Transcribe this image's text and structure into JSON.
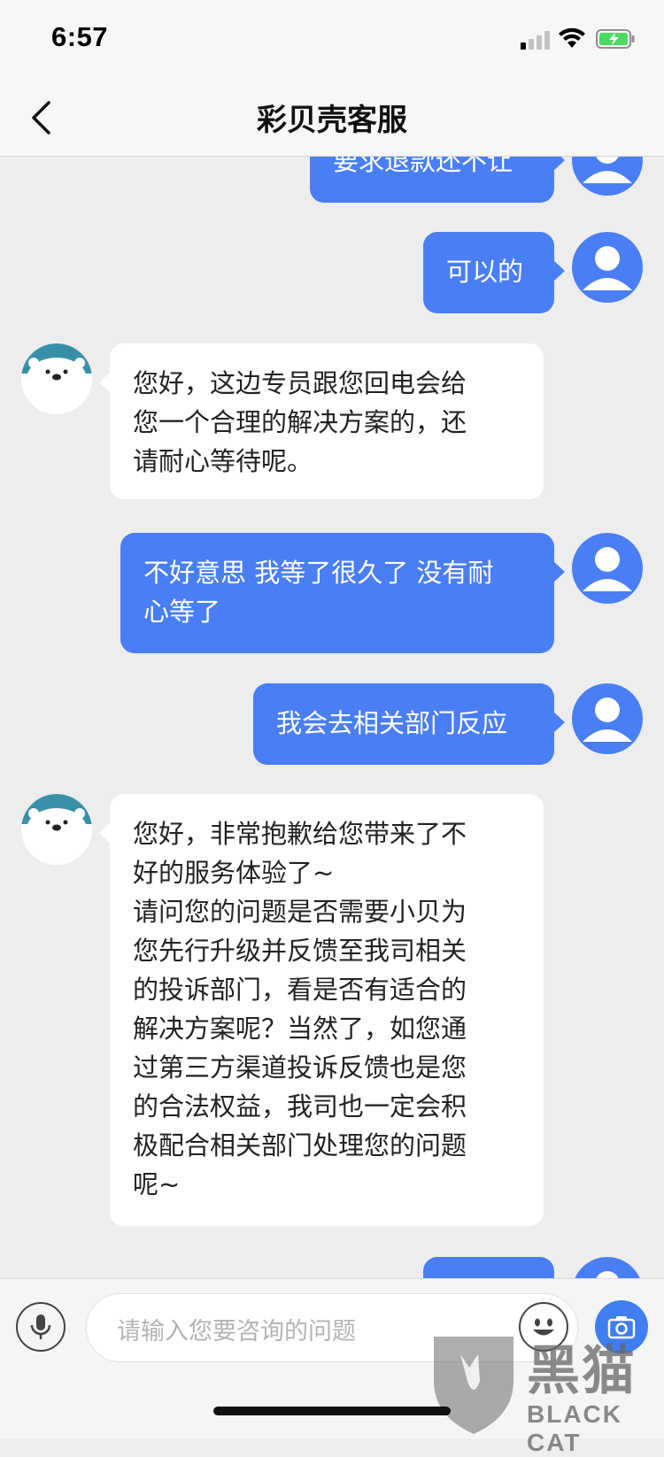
{
  "status_bar": {
    "time": "6:57"
  },
  "header": {
    "title": "彩贝壳客服"
  },
  "messages": [
    {
      "from": "user",
      "text": "要求退款还不让"
    },
    {
      "from": "user",
      "text": "可以的"
    },
    {
      "from": "bot",
      "text": "您好，这边专员跟您回电会给\n您一个合理的解决方案的，还\n请耐心等待呢。"
    },
    {
      "from": "user",
      "text": "不好意思 我等了很久了 没有耐\n心等了"
    },
    {
      "from": "user",
      "text": "我会去相关部门反应"
    },
    {
      "from": "bot",
      "text": "您好，非常抱歉给您带来了不\n好的服务体验了~\n请问您的问题是否需要小贝为\n您先行升级并反馈至我司相关\n的投诉部门，看是否有适合的\n解决方案呢？当然了，如您通\n过第三方渠道投诉反馈也是您\n的合法权益，我司也一定会积\n极配合相关部门处理您的问题\n呢~"
    },
    {
      "from": "user",
      "text": ""
    }
  ],
  "input": {
    "placeholder": "请输入您要咨询的问题"
  },
  "watermark": {
    "title": "黑猫",
    "subtitle": "BLACK CAT"
  },
  "colors": {
    "accent": "#4a7ef4",
    "background": "#ededed",
    "bot_avatar": "#3a8fa8"
  },
  "icons": [
    "back-chevron-icon",
    "signal-icon",
    "wifi-icon",
    "battery-icon",
    "user-avatar-icon",
    "bot-bear-avatar-icon",
    "microphone-icon",
    "emoji-icon",
    "camera-icon"
  ]
}
